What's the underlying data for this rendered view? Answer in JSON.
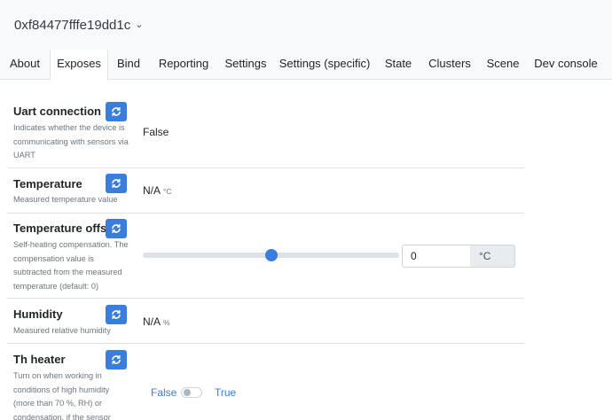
{
  "header": {
    "device_id": "0xf84477fffe19dd1c"
  },
  "tabs": [
    {
      "label": "About"
    },
    {
      "label": "Exposes",
      "active": true
    },
    {
      "label": "Bind"
    },
    {
      "label": "Reporting"
    },
    {
      "label": "Settings"
    },
    {
      "label": "Settings (specific)"
    },
    {
      "label": "State"
    },
    {
      "label": "Clusters"
    },
    {
      "label": "Scene"
    },
    {
      "label": "Dev console"
    }
  ],
  "exposes": {
    "uart": {
      "title": "Uart connection",
      "description": "Indicates whether the device is communicating with sensors via UART",
      "value": "False"
    },
    "temperature": {
      "title": "Temperature",
      "description": "Measured temperature value",
      "value": "N/A",
      "unit": "°C"
    },
    "temperature_offset": {
      "title": "Temperature offset",
      "description": "Self-heating compensation. The compensation value is subtracted from the measured temperature (default: 0)",
      "value": "0",
      "unit": "°C",
      "slider_level": 0.5
    },
    "humidity": {
      "title": "Humidity",
      "description": "Measured relative humidity",
      "value": "N/A",
      "unit": "%"
    },
    "th_heater": {
      "title": "Th heater",
      "description": "Turn on when working in conditions of high humidity (more than 70 %, RH) or condensation, if the sensor",
      "false_label": "False",
      "true_label": "True",
      "state": false
    }
  },
  "colors": {
    "accent": "#3b7ddd",
    "muted": "#6c757d",
    "border": "#dee2e6"
  },
  "icons": {
    "refresh": "refresh-icon",
    "dropdown": "chevron-down-icon"
  }
}
